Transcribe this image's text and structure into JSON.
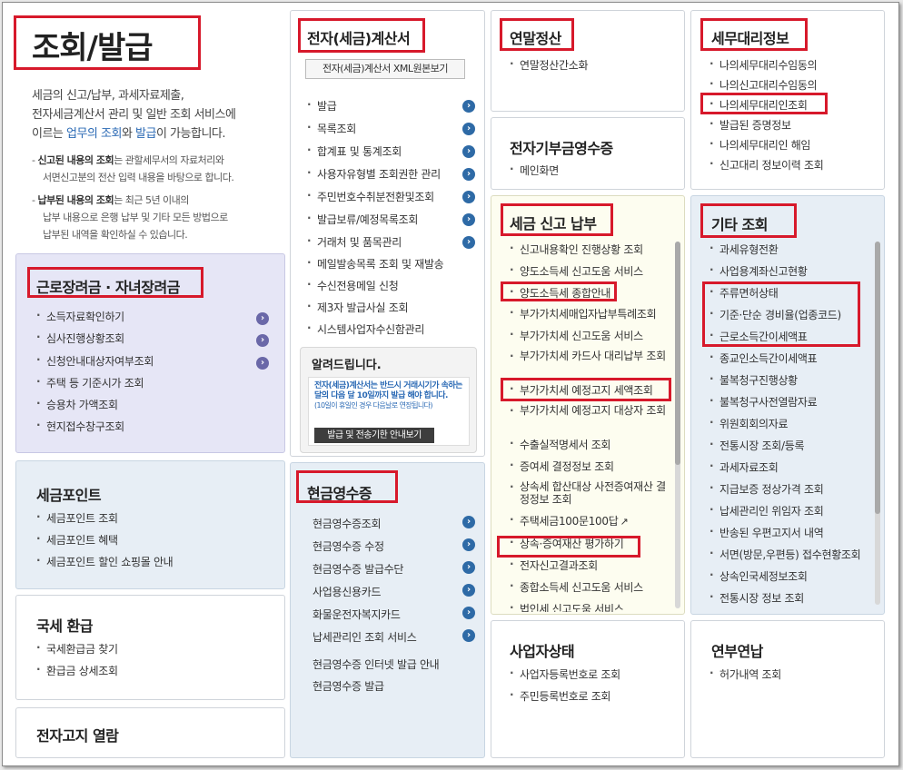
{
  "hero": {
    "title": "조회/발급",
    "desc1": "세금의 신고/납부, 과세자료제출,",
    "desc2": "전자세금계산서 관리 및 일반 조회 서비스에",
    "desc3_a": "이르는 ",
    "desc3_link1": "업무의 조회",
    "desc3_b": "와 ",
    "desc3_link2": "발급",
    "desc3_c": "이 가능합니다.",
    "note1_bold": "신고된 내용의 조회",
    "note1_rest": "는 관할세무서의 자료처리와",
    "note1_line2": "서면신고분의 전산 입력 내용을 바탕으로 합니다.",
    "note2_bold": "납부된 내용의 조회",
    "note2_rest": "는 최근 5년 이내의",
    "note2_line2": "납부 내용으로 은행 납부 및 기타 모든 방법으로",
    "note2_line3": "납부된 내역을 확인하실 수 있습니다."
  },
  "labor": {
    "title": "근로장려금 · 자녀장려금",
    "items": [
      "소득자료확인하기",
      "심사진행상황조회",
      "신청안내대상자여부조회",
      "주택 등 기준시가 조회",
      "승용차 가액조회",
      "현지접수창구조회"
    ]
  },
  "point": {
    "title": "세금포인트",
    "items": [
      "세금포인트 조회",
      "세금포인트 혜택",
      "세금포인트 할인 쇼핑몰 안내"
    ]
  },
  "refund": {
    "title": "국세 환급",
    "items": [
      "국세환급금 찾기",
      "환급금 상세조회"
    ]
  },
  "enotice": {
    "title": "전자고지 열람"
  },
  "einvoice": {
    "title": "전자(세금)계산서",
    "xml_button": "전자(세금)계산서 XML원본보기",
    "items": [
      "발급",
      "목록조회",
      "합계표 및 통계조회",
      "사용자유형별 조회권한 관리",
      "주민번호수취분전환및조회",
      "발급보류/예정목록조회",
      "거래처 및 품목관리",
      "메일발송목록 조회 및 재발송",
      "수신전용메일 신청",
      "제3자 발급사실 조회",
      "시스템사업자수신함관리"
    ],
    "notice_title": "알려드립니다.",
    "notice_text": "전자(세금)계산서는 반드시 거래시기가 속하는 달의 다음 달 10일까지 발급 해야 합니다.",
    "notice_sub": "(10일이 휴일인 경우 다음날로 연장됩니다)",
    "notice_button": "발급 및 전송기한 안내보기"
  },
  "cash": {
    "title": "현금영수증",
    "items": [
      "현금영수증조회",
      "현금영수증 수정",
      "현금영수증 발급수단",
      "사업용신용카드",
      "화물운전자복지카드",
      "납세관리인 조회 서비스"
    ],
    "extra": [
      "현금영수증 인터넷 발급 안내",
      "현금영수증 발급"
    ]
  },
  "yearend": {
    "title": "연말정산",
    "items": [
      "연말정산간소화"
    ]
  },
  "donation": {
    "title": "전자기부금영수증",
    "items": [
      "메인화면"
    ]
  },
  "taxfile": {
    "title": "세금 신고 납부",
    "items": [
      "신고내용확인 진행상황 조회",
      "양도소득세 신고도움 서비스",
      "양도소득세 종합안내",
      "부가가치세매입자납부특례조회",
      "부가가치세 신고도움 서비스",
      "부가가치세 카드사 대리납부 조회",
      "부가가치세 예정고지 세액조회",
      "부가가치세 예정고지 대상자 조회",
      "수출실적명세서 조회",
      "증여세 결정정보 조회",
      "상속세 합산대상 사전증여재산 결정정보 조회",
      "주택세금100문100답",
      "상속·증여재산 평가하기",
      "전자신고결과조회",
      "종합소득세 신고도움 서비스",
      "법인세 신고도움 서비스"
    ],
    "ext_icon": "external-link-icon"
  },
  "bizstatus": {
    "title": "사업자상태",
    "items": [
      "사업자등록번호로 조회",
      "주민등록번호로 조회"
    ]
  },
  "agent": {
    "title": "세무대리정보",
    "items": [
      "나의세무대리수임동의",
      "나의신고대리수임동의",
      "나의세무대리인조회",
      "발급된 증명정보",
      "나의세무대리인 해임",
      "신고대리 정보이력 조회"
    ]
  },
  "other": {
    "title": "기타 조회",
    "items": [
      "과세유형전환",
      "사업용계좌신고현황",
      "주류면허상태",
      "기준·단순 경비율(업종코드)",
      "근로소득간이세액표",
      "종교인소득간이세액표",
      "불복청구진행상황",
      "불복청구사전열람자료",
      "위원회회의자료",
      "전통시장 조회/등록",
      "과세자료조회",
      "지급보증 정상가격 조회",
      "납세관리인 위임자 조회",
      "반송된 우편고지서 내역",
      "서면(방문,우편등) 접수현황조회",
      "상속인국세정보조회",
      "전통시장 정보 조회"
    ]
  },
  "installment": {
    "title": "연부연납",
    "items": [
      "허가내역 조회"
    ]
  },
  "colors": {
    "highlight": "#d7192b",
    "arrow_blue": "#2e6aa6",
    "arrow_purple": "#6a68a8",
    "link": "#2a69b4"
  },
  "icons": {
    "arrow": "chevron-right-icon"
  }
}
